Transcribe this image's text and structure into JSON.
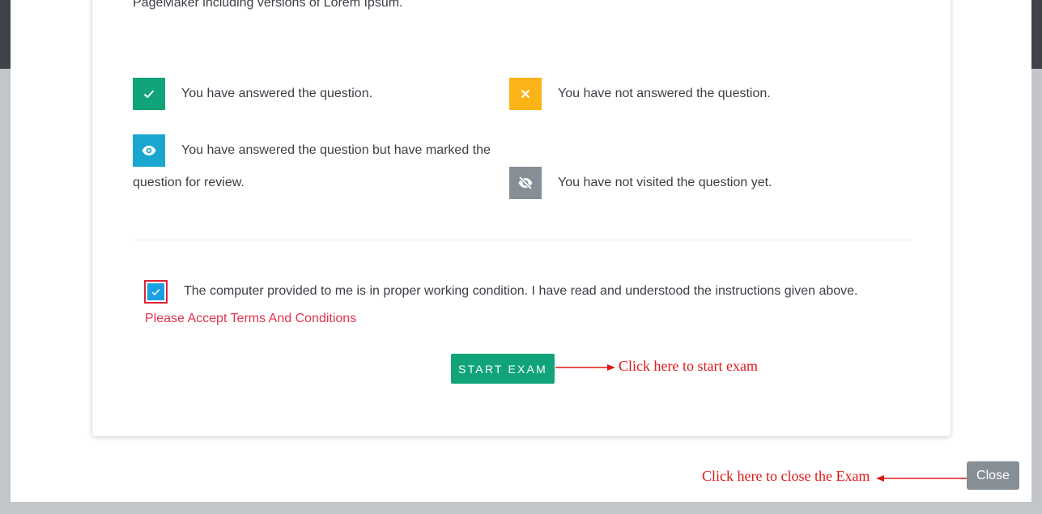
{
  "intro_text": "PageMaker including versions of Lorem Ipsum.",
  "legend": {
    "answered": {
      "text": "You have answered the question.",
      "icon": "check-icon",
      "color": "#11a37a"
    },
    "not_answered": {
      "text": "You have not answered the question.",
      "icon": "close-icon",
      "color": "#fbb318"
    },
    "marked_review": {
      "text": "You have answered the question but have marked the question for review.",
      "icon": "eye-icon",
      "color": "#19a6cf"
    },
    "not_visited": {
      "text": "You have not visited the question yet.",
      "icon": "eye-slash-icon",
      "color": "#868e96"
    }
  },
  "agreement": {
    "text": "The computer provided to me is in proper working condition. I have read and understood the instructions given above.",
    "checked": true,
    "error": "Please Accept Terms And Conditions"
  },
  "start_button": {
    "label": "START EXAM"
  },
  "start_hint": "Click here to start exam",
  "close_button": {
    "label": "Close"
  },
  "close_hint": "Click here to close the Exam"
}
